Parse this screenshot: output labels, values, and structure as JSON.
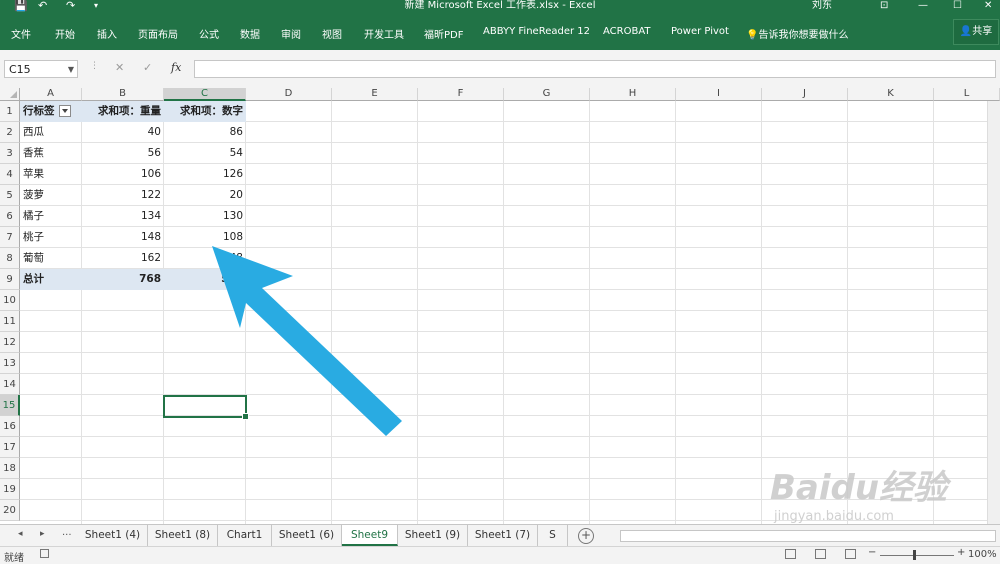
{
  "window": {
    "title": "新建 Microsoft Excel 工作表.xlsx  -  Excel",
    "user": "刘东",
    "qa_save": "💾",
    "qa_undo": "↶",
    "qa_redo": "↷",
    "qa_more": "▾",
    "ribbon_display": "⊡",
    "minimize": "—",
    "maximize": "☐",
    "close": "✕"
  },
  "ribbon": {
    "tabs": [
      "文件",
      "开始",
      "插入",
      "页面布局",
      "公式",
      "数据",
      "审阅",
      "视图",
      "开发工具",
      "福昕PDF",
      "ABBYY FineReader 12",
      "ACROBAT",
      "Power Pivot"
    ],
    "tell_me": "告诉我你想要做什么",
    "share": "共享"
  },
  "formula_bar": {
    "name_box": "C15",
    "cancel": "✕",
    "enter": "✓",
    "fx": "fx",
    "formula": ""
  },
  "grid": {
    "columns": [
      "A",
      "B",
      "C",
      "D",
      "E",
      "F",
      "G",
      "H",
      "I",
      "J",
      "K",
      "L"
    ],
    "rows": [
      "1",
      "2",
      "3",
      "4",
      "5",
      "6",
      "7",
      "8",
      "9",
      "10",
      "11",
      "12",
      "13",
      "14",
      "15",
      "16",
      "17",
      "18",
      "19",
      "20"
    ],
    "selected_column": "C",
    "selected_row": "15"
  },
  "pivot": {
    "headers": [
      "行标签",
      "求和项：重量",
      "求和项：数字"
    ],
    "rows": [
      {
        "label": "西瓜",
        "weight": "40",
        "number": "86"
      },
      {
        "label": "香蕉",
        "weight": "56",
        "number": "54"
      },
      {
        "label": "苹果",
        "weight": "106",
        "number": "126"
      },
      {
        "label": "菠萝",
        "weight": "122",
        "number": "20"
      },
      {
        "label": "橘子",
        "weight": "134",
        "number": "130"
      },
      {
        "label": "桃子",
        "weight": "148",
        "number": "108"
      },
      {
        "label": "葡萄",
        "weight": "162",
        "number": "48"
      }
    ],
    "total": {
      "label": "总计",
      "weight": "768",
      "number": "572"
    }
  },
  "sheet_tabs": {
    "nav_prev": "◂",
    "nav_next": "▸",
    "ellipsis": "...",
    "tabs": [
      "Sheet1 (4)",
      "Sheet1 (8)",
      "Chart1",
      "Sheet1 (6)",
      "Sheet9",
      "Sheet1 (9)",
      "Sheet1 (7)",
      "S"
    ],
    "active": "Sheet9",
    "add": "+"
  },
  "status": {
    "ready": "就绪",
    "zoom": "100%",
    "zoom_minus": "−",
    "zoom_plus": "+"
  },
  "watermark": {
    "brand": "Baidu经验",
    "url": "jingyan.baidu.com"
  },
  "colors": {
    "excel_green": "#217346",
    "pivot_header_fill": "#dde7f2",
    "arrow": "#29abe2"
  }
}
